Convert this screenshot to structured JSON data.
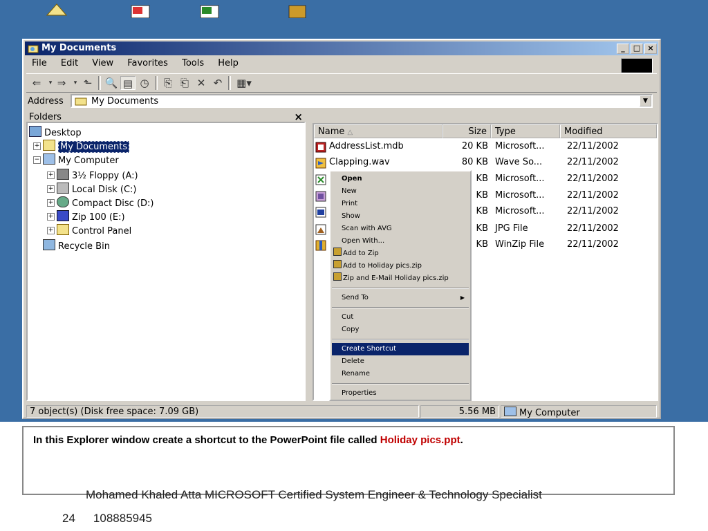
{
  "window": {
    "title": "My Documents"
  },
  "menubar": [
    "File",
    "Edit",
    "View",
    "Favorites",
    "Tools",
    "Help"
  ],
  "address": {
    "label": "Address",
    "value": "My Documents"
  },
  "folders": {
    "header": "Folders",
    "close": "×",
    "items": [
      {
        "label": "Desktop",
        "icon": "desktop-icon"
      },
      {
        "label": "My Documents",
        "icon": "folder-icon",
        "selected": true
      },
      {
        "label": "My Computer",
        "icon": "computer-icon"
      },
      {
        "label": "3½ Floppy (A:)",
        "icon": "floppy-icon"
      },
      {
        "label": "Local Disk (C:)",
        "icon": "disk-icon"
      },
      {
        "label": "Compact Disc (D:)",
        "icon": "cd-icon"
      },
      {
        "label": "Zip 100  (E:)",
        "icon": "zip-drive-icon"
      },
      {
        "label": "Control Panel",
        "icon": "control-panel-icon"
      },
      {
        "label": "Recycle Bin",
        "icon": "recycle-bin-icon"
      }
    ]
  },
  "columns": [
    "Name",
    "Size",
    "Type",
    "Modified"
  ],
  "files": [
    {
      "name": "AddressList.mdb",
      "size": "20 KB",
      "type": "Microsoft...",
      "modified": "22/11/2002"
    },
    {
      "name": "Clapping.wav",
      "size": "80 KB",
      "type": "Wave So...",
      "modified": "22/11/2002"
    },
    {
      "name": "",
      "size": "KB",
      "type": "Microsoft...",
      "modified": "22/11/2002"
    },
    {
      "name": "",
      "size": "KB",
      "type": "Microsoft...",
      "modified": "22/11/2002"
    },
    {
      "name": "",
      "size": "KB",
      "type": "Microsoft...",
      "modified": "22/11/2002"
    },
    {
      "name": "",
      "size": "KB",
      "type": "JPG File",
      "modified": "22/11/2002"
    },
    {
      "name": "",
      "size": "KB",
      "type": "WinZip File",
      "modified": "22/11/2002"
    }
  ],
  "context_menu": [
    {
      "label": "Open",
      "bold": true
    },
    {
      "label": "New"
    },
    {
      "label": "Print"
    },
    {
      "label": "Show"
    },
    {
      "label": "Scan with AVG"
    },
    {
      "label": "Open With..."
    },
    {
      "label": "Add to Zip",
      "icon": true
    },
    {
      "label": "Add to Holiday pics.zip",
      "icon": true
    },
    {
      "label": "Zip and E-Mail Holiday pics.zip",
      "icon": true
    },
    {
      "sep": true
    },
    {
      "label": "Send To",
      "submenu": true
    },
    {
      "sep": true
    },
    {
      "label": "Cut"
    },
    {
      "label": "Copy"
    },
    {
      "sep": true
    },
    {
      "label": "Create Shortcut",
      "highlight": true
    },
    {
      "label": "Delete"
    },
    {
      "label": "Rename"
    },
    {
      "sep": true
    },
    {
      "label": "Properties"
    }
  ],
  "status": {
    "objects": "7 object(s) (Disk free space: 7.09 GB)",
    "size": "5.56 MB",
    "zone": "My Computer"
  },
  "instruction": {
    "prefix": "In this Explorer window create a shortcut to the PowerPoint file called ",
    "highlight": "Holiday pics.ppt",
    "suffix": "."
  },
  "footer": {
    "line1": "Mohamed Khaled Atta MICROSOFT Certified System Engineer & Technology Specialist",
    "page": "24",
    "phone": "108885945"
  }
}
